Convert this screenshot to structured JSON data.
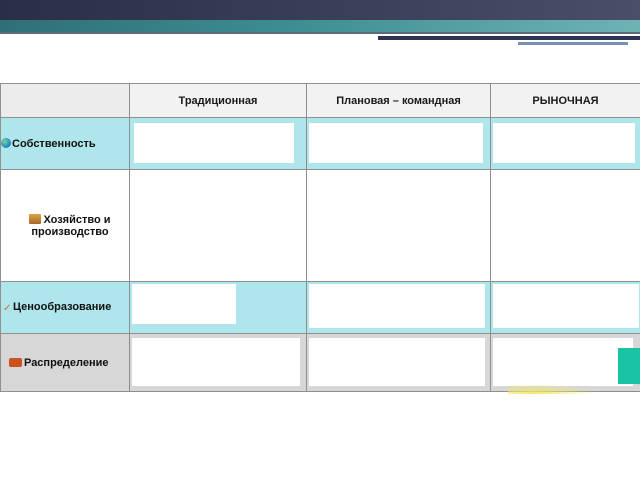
{
  "columns": [
    "Традиционная",
    "Плановая – командная",
    "РЫНОЧНАЯ"
  ],
  "rows": [
    {
      "label": "Собственность",
      "icon": "globe-icon"
    },
    {
      "label": "Хозяйство и",
      "label2": "производство",
      "icon": "factory-icon"
    },
    {
      "label": "Ценообразование",
      "icon": "price-spark-icon"
    },
    {
      "label": "Распределение",
      "icon": "truck-icon"
    }
  ],
  "colors": {
    "teal_row": "#aee6ec",
    "gray_row": "#d7d7d7",
    "header_dark": "#2b2f45",
    "header_teal": "#3c8d92"
  }
}
